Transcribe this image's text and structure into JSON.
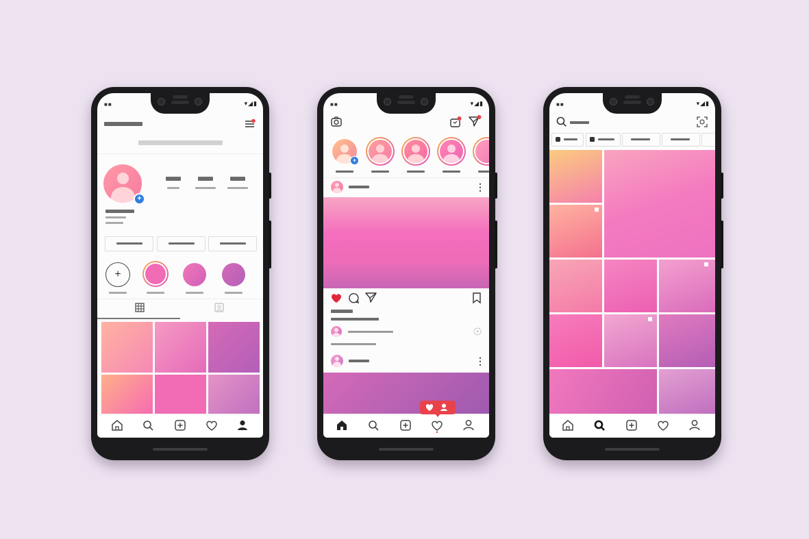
{
  "status": {
    "signal": "■■",
    "icons": "▾◢▮"
  },
  "colors": {
    "background": "#ece2f0",
    "accent_pink": "#f26bb5",
    "like_red": "#e0283c",
    "notify_red": "#e9424b",
    "add_blue": "#2f7de0"
  },
  "profile_screen": {
    "story_add_symbol": "+",
    "tabs": [
      "grid-icon",
      "tagged-icon"
    ],
    "nav": [
      "home-icon",
      "search-icon",
      "add-post-icon",
      "heart-icon",
      "profile-icon"
    ]
  },
  "feed_screen": {
    "more_symbol": "⋮",
    "nav": [
      "home-icon",
      "search-icon",
      "add-post-icon",
      "heart-icon",
      "profile-icon"
    ],
    "activity_badge_icons": [
      "heart-icon",
      "person-icon"
    ]
  },
  "explore_screen": {
    "nav": [
      "home-icon",
      "search-icon",
      "add-post-icon",
      "heart-icon",
      "profile-icon"
    ]
  }
}
